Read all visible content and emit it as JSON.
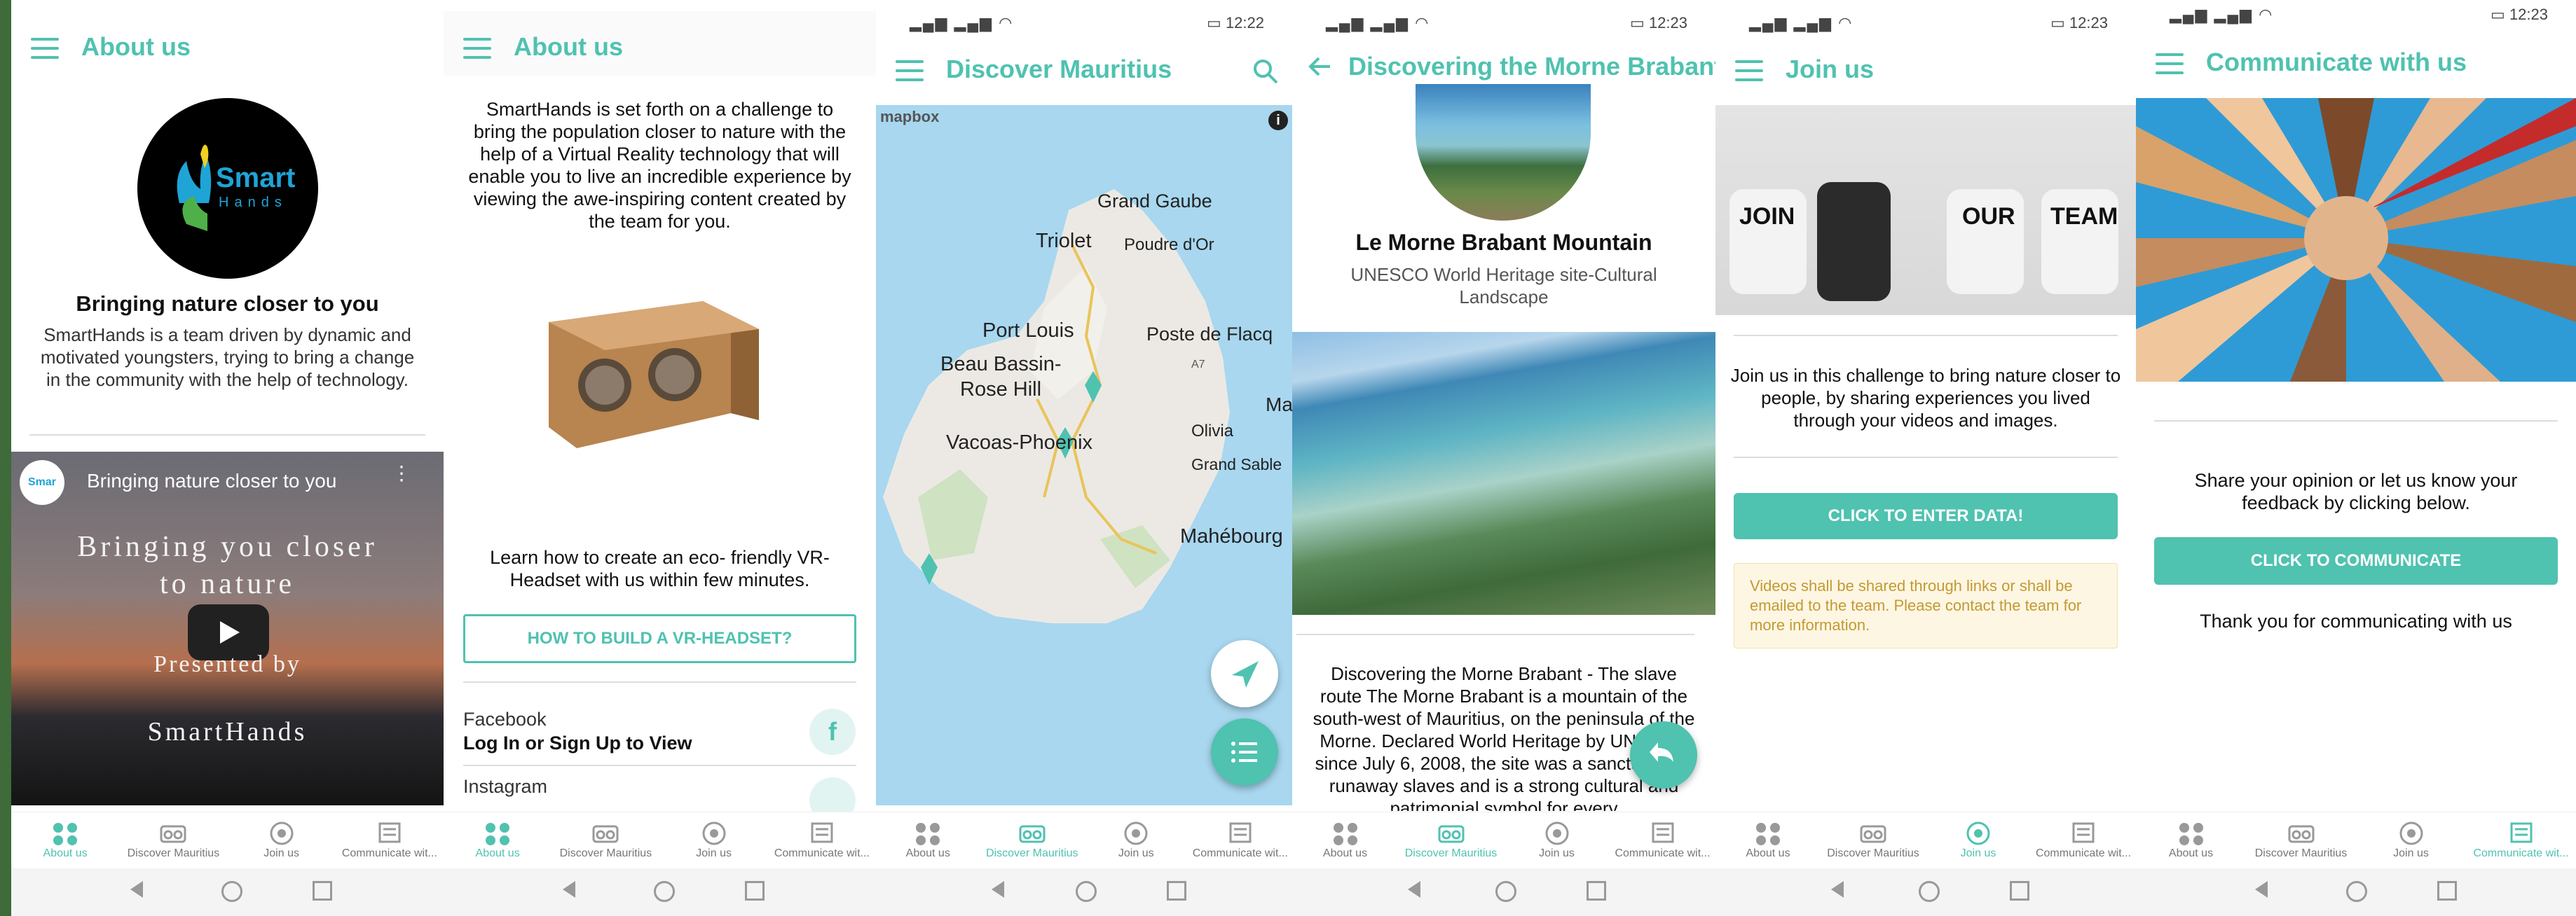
{
  "colors": {
    "accent": "#4fc2b0",
    "warning_bg": "#fdf6e3",
    "warning_text": "#c39a32",
    "frame": "#3f6a3a"
  },
  "nav": [
    "About us",
    "Discover Mauritius",
    "Join us",
    "Communicate wit..."
  ],
  "screen1": {
    "title": "About us",
    "logo": {
      "word1": "Smart",
      "word2": "Hands"
    },
    "headline": "Bringing nature closer to you",
    "body": "SmartHands is a team driven by dynamic and motivated youngsters, trying to bring a change in the community with the help of technology.",
    "video": {
      "title": "Bringing nature closer to you",
      "avatar": "Smar",
      "line1": "Bringing you closer",
      "line2": "to nature",
      "line3": "Presented by",
      "line4": "SmartHands"
    }
  },
  "screen2": {
    "title": "About us",
    "intro": "SmartHands is set forth on a challenge to bring the population closer to nature with the help of a Virtual Reality technology that will enable you to live an incredible experience by viewing the awe-inspiring content created by the team for you.",
    "learn": "Learn how to create an eco- friendly VR-Headset with us within few minutes.",
    "button": "HOW TO BUILD A VR-HEADSET?",
    "facebook": {
      "name": "Facebook",
      "action": "Log In or Sign Up to View"
    },
    "instagram": {
      "name": "Instagram"
    }
  },
  "screen3": {
    "time": "12:22",
    "title": "Discover Mauritius",
    "attribution": "mapbox",
    "places": [
      "Grand Gaube",
      "Triolet",
      "Poudre d'Or",
      "Port Louis",
      "Poste de Flacq",
      "Beau Bassin-",
      "Rose Hill",
      "A7",
      "Ma",
      "Olivia",
      "Vacoas-Phoenix",
      "Grand Sable",
      "Mahébourg"
    ]
  },
  "screen4": {
    "time": "12:23",
    "title": "Discovering the Morne Brabant - ...",
    "heading": "Le Morne Brabant Mountain",
    "subheading": "UNESCO World Heritage site-Cultural Landscape",
    "description": "Discovering the Morne Brabant - The slave route The Morne Brabant is a mountain of the south-west of Mauritius, on the peninsula of the Morne. Declared World Heritage by UNESCO since July 6, 2008, the site was a sanctuary for runaway slaves and is a strong cultural and patrimonial symbol for every"
  },
  "screen5": {
    "time": "12:23",
    "title": "Join us",
    "chairs": [
      "JOIN",
      "OUR",
      "TEAM"
    ],
    "body": "Join us in this challenge to bring nature closer to people, by sharing experiences you lived through your videos and images.",
    "button": "CLICK TO ENTER DATA!",
    "notice": "Videos shall be shared through links or shall be emailed to the team. Please contact the team for more information."
  },
  "screen6": {
    "time": "12:23",
    "title": "Communicate with us",
    "body": "Share your opinion or let us know your feedback by clicking below.",
    "button": "CLICK TO COMMUNICATE",
    "thanks": "Thank you for communicating with us"
  }
}
